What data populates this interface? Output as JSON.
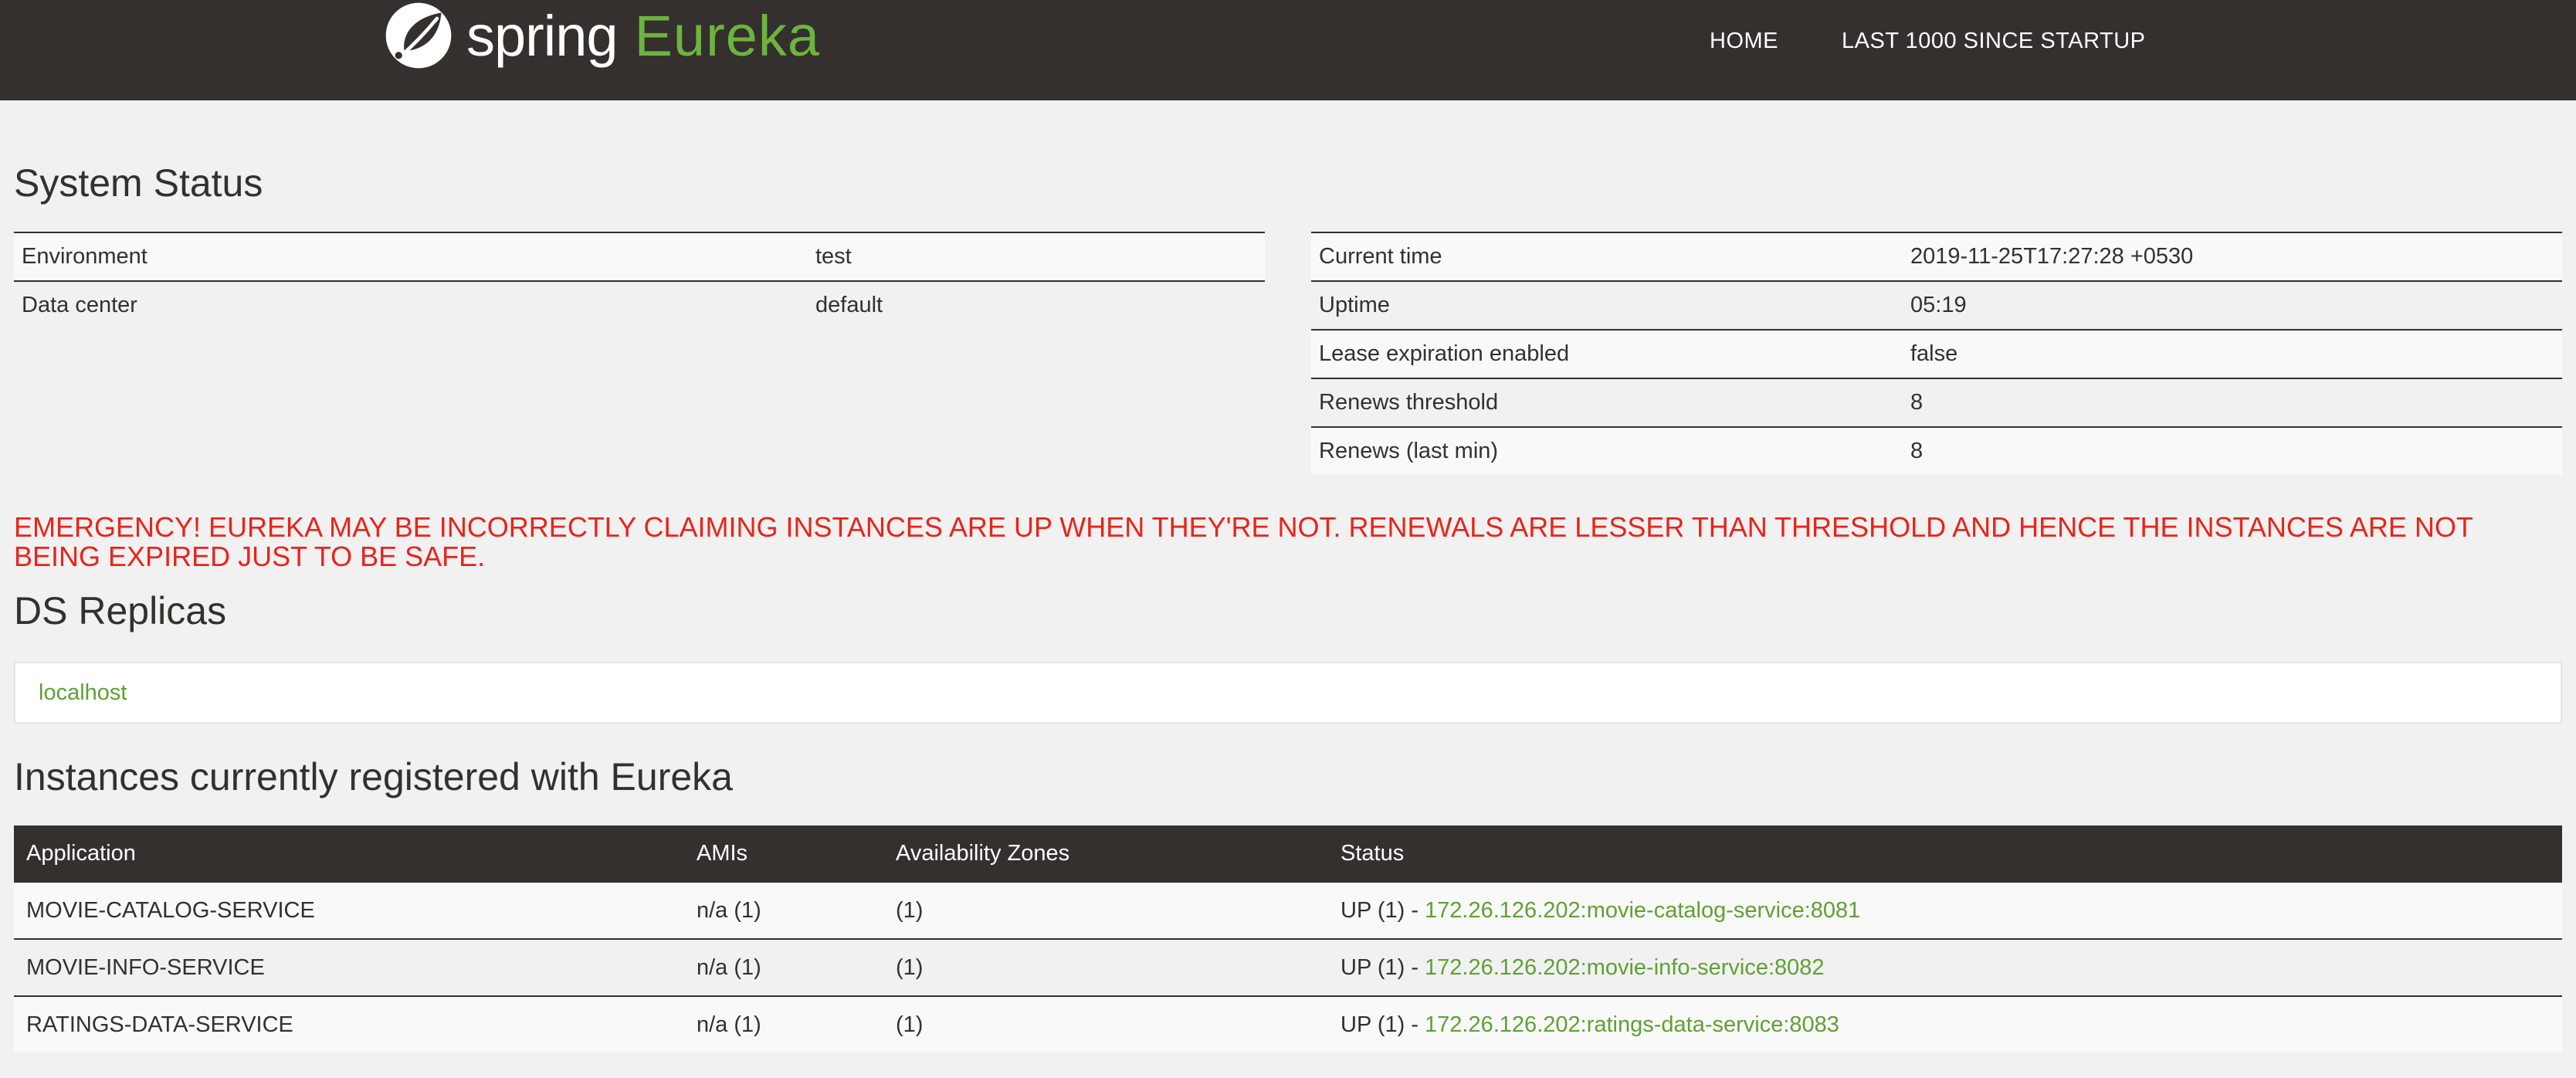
{
  "header": {
    "brand_spring": "spring",
    "brand_eureka": "Eureka",
    "nav": {
      "home": "HOME",
      "last_1000": "LAST 1000 SINCE STARTUP"
    }
  },
  "system_status": {
    "title": "System Status",
    "left_table": [
      {
        "label": "Environment",
        "value": "test"
      },
      {
        "label": "Data center",
        "value": "default"
      }
    ],
    "right_table": [
      {
        "label": "Current time",
        "value": "2019-11-25T17:27:28 +0530"
      },
      {
        "label": "Uptime",
        "value": "05:19"
      },
      {
        "label": "Lease expiration enabled",
        "value": "false"
      },
      {
        "label": "Renews threshold",
        "value": "8"
      },
      {
        "label": "Renews (last min)",
        "value": "8"
      }
    ]
  },
  "emergency": "EMERGENCY! EUREKA MAY BE INCORRECTLY CLAIMING INSTANCES ARE UP WHEN THEY'RE NOT. RENEWALS ARE LESSER THAN THRESHOLD AND HENCE THE INSTANCES ARE NOT BEING EXPIRED JUST TO BE SAFE.",
  "replicas": {
    "title": "DS Replicas",
    "items": [
      "localhost"
    ]
  },
  "instances": {
    "title": "Instances currently registered with Eureka",
    "columns": [
      "Application",
      "AMIs",
      "Availability Zones",
      "Status"
    ],
    "rows": [
      {
        "application": "MOVIE-CATALOG-SERVICE",
        "amis": "n/a (1)",
        "zones": "(1)",
        "status_prefix": "UP (1) - ",
        "status_link": "172.26.126.202:movie-catalog-service:8081"
      },
      {
        "application": "MOVIE-INFO-SERVICE",
        "amis": "n/a (1)",
        "zones": "(1)",
        "status_prefix": "UP (1) - ",
        "status_link": "172.26.126.202:movie-info-service:8082"
      },
      {
        "application": "RATINGS-DATA-SERVICE",
        "amis": "n/a (1)",
        "zones": "(1)",
        "status_prefix": "UP (1) - ",
        "status_link": "172.26.126.202:ratings-data-service:8083"
      }
    ]
  },
  "colors": {
    "nav_bg": "#34302d",
    "brand_green": "#6db33f",
    "link_green": "#5fa134",
    "emergency_red": "#e8241b",
    "page_bg": "#f1f1f1"
  }
}
